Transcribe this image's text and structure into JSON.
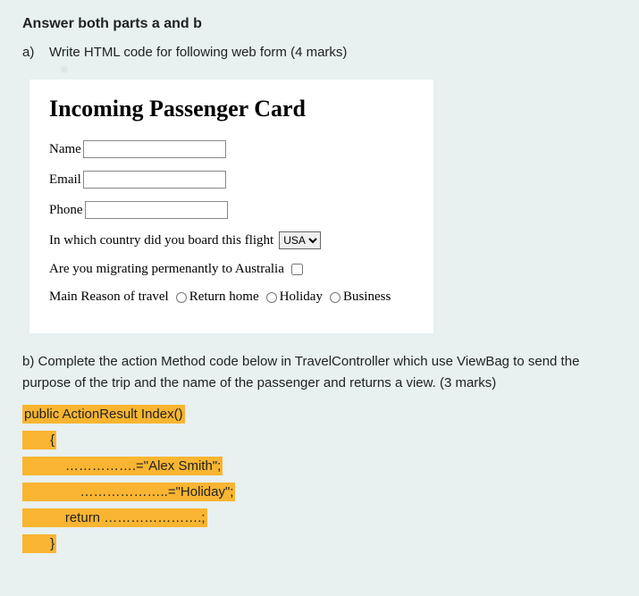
{
  "heading": "Answer both parts a and b",
  "partA": {
    "label": "a)",
    "text": "Write HTML code for following web form (4 marks)"
  },
  "form": {
    "title": "Incoming Passenger Card",
    "nameLabel": "Name",
    "emailLabel": "Email",
    "phoneLabel": "Phone",
    "countryQuestion": "In which country did you board this flight",
    "countrySelected": "USA",
    "migrateQuestion": "Are you migrating permenantly to Australia",
    "reasonLabel": "Main Reason of travel",
    "reasons": {
      "r1": "Return home",
      "r2": "Holiday",
      "r3": "Business"
    }
  },
  "partB": {
    "text": "b) Complete the action Method code below in TravelController which use ViewBag to send the purpose of the trip and the name of the passenger and returns a view. (3 marks)"
  },
  "code": {
    "line1": "public ActionResult Index()",
    "line2": "       {",
    "line3": "           …………….=\"Alex Smith\";",
    "line4": "               ………………..=\"Holiday\";",
    "line5": "           return ………………….;",
    "line6": "       }"
  }
}
